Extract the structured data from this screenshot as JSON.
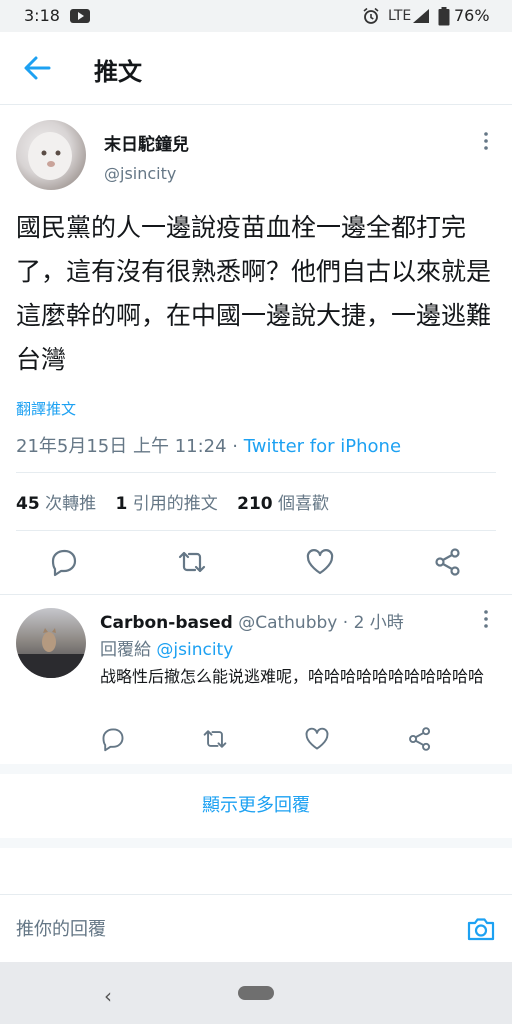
{
  "status_bar": {
    "time": "3:18",
    "network": "LTE",
    "battery": "76%"
  },
  "header": {
    "title": "推文"
  },
  "tweet": {
    "name": "末日駝鐘兒",
    "handle": "@jsincity",
    "text": "國民黨的人一邊說疫苗血栓一邊全都打完了，這有沒有很熟悉啊？他們自古以來就是這麼幹的啊，在中國一邊說大捷，一邊逃難台灣",
    "translate": "翻譯推文",
    "timestamp": "21年5月15日 上午 11:24 · ",
    "source": "Twitter for iPhone",
    "stats": {
      "retweets_count": "45",
      "retweets_label": "次轉推",
      "quotes_count": "1",
      "quotes_label": "引用的推文",
      "likes_count": "210",
      "likes_label": "個喜歡"
    }
  },
  "reply": {
    "name": "Carbon-based",
    "handle": "@Cathubby",
    "time": " · 2 小時",
    "replying_to_label": "回覆給 ",
    "replying_to_handle": "@jsincity",
    "text": "战略性后撤怎么能说逃难呢，哈哈哈哈哈哈哈哈哈哈哈"
  },
  "show_more": "顯示更多回覆",
  "composer": {
    "placeholder": "推你的回覆"
  },
  "colors": {
    "accent": "#1da1f2",
    "secondary_text": "#657786",
    "divider": "#e6ecf0"
  },
  "icons": [
    "back-arrow-icon",
    "more-vertical-icon",
    "reply-icon",
    "retweet-icon",
    "like-icon",
    "share-icon",
    "camera-icon",
    "youtube-icon",
    "alarm-icon",
    "signal-icon",
    "battery-icon"
  ]
}
